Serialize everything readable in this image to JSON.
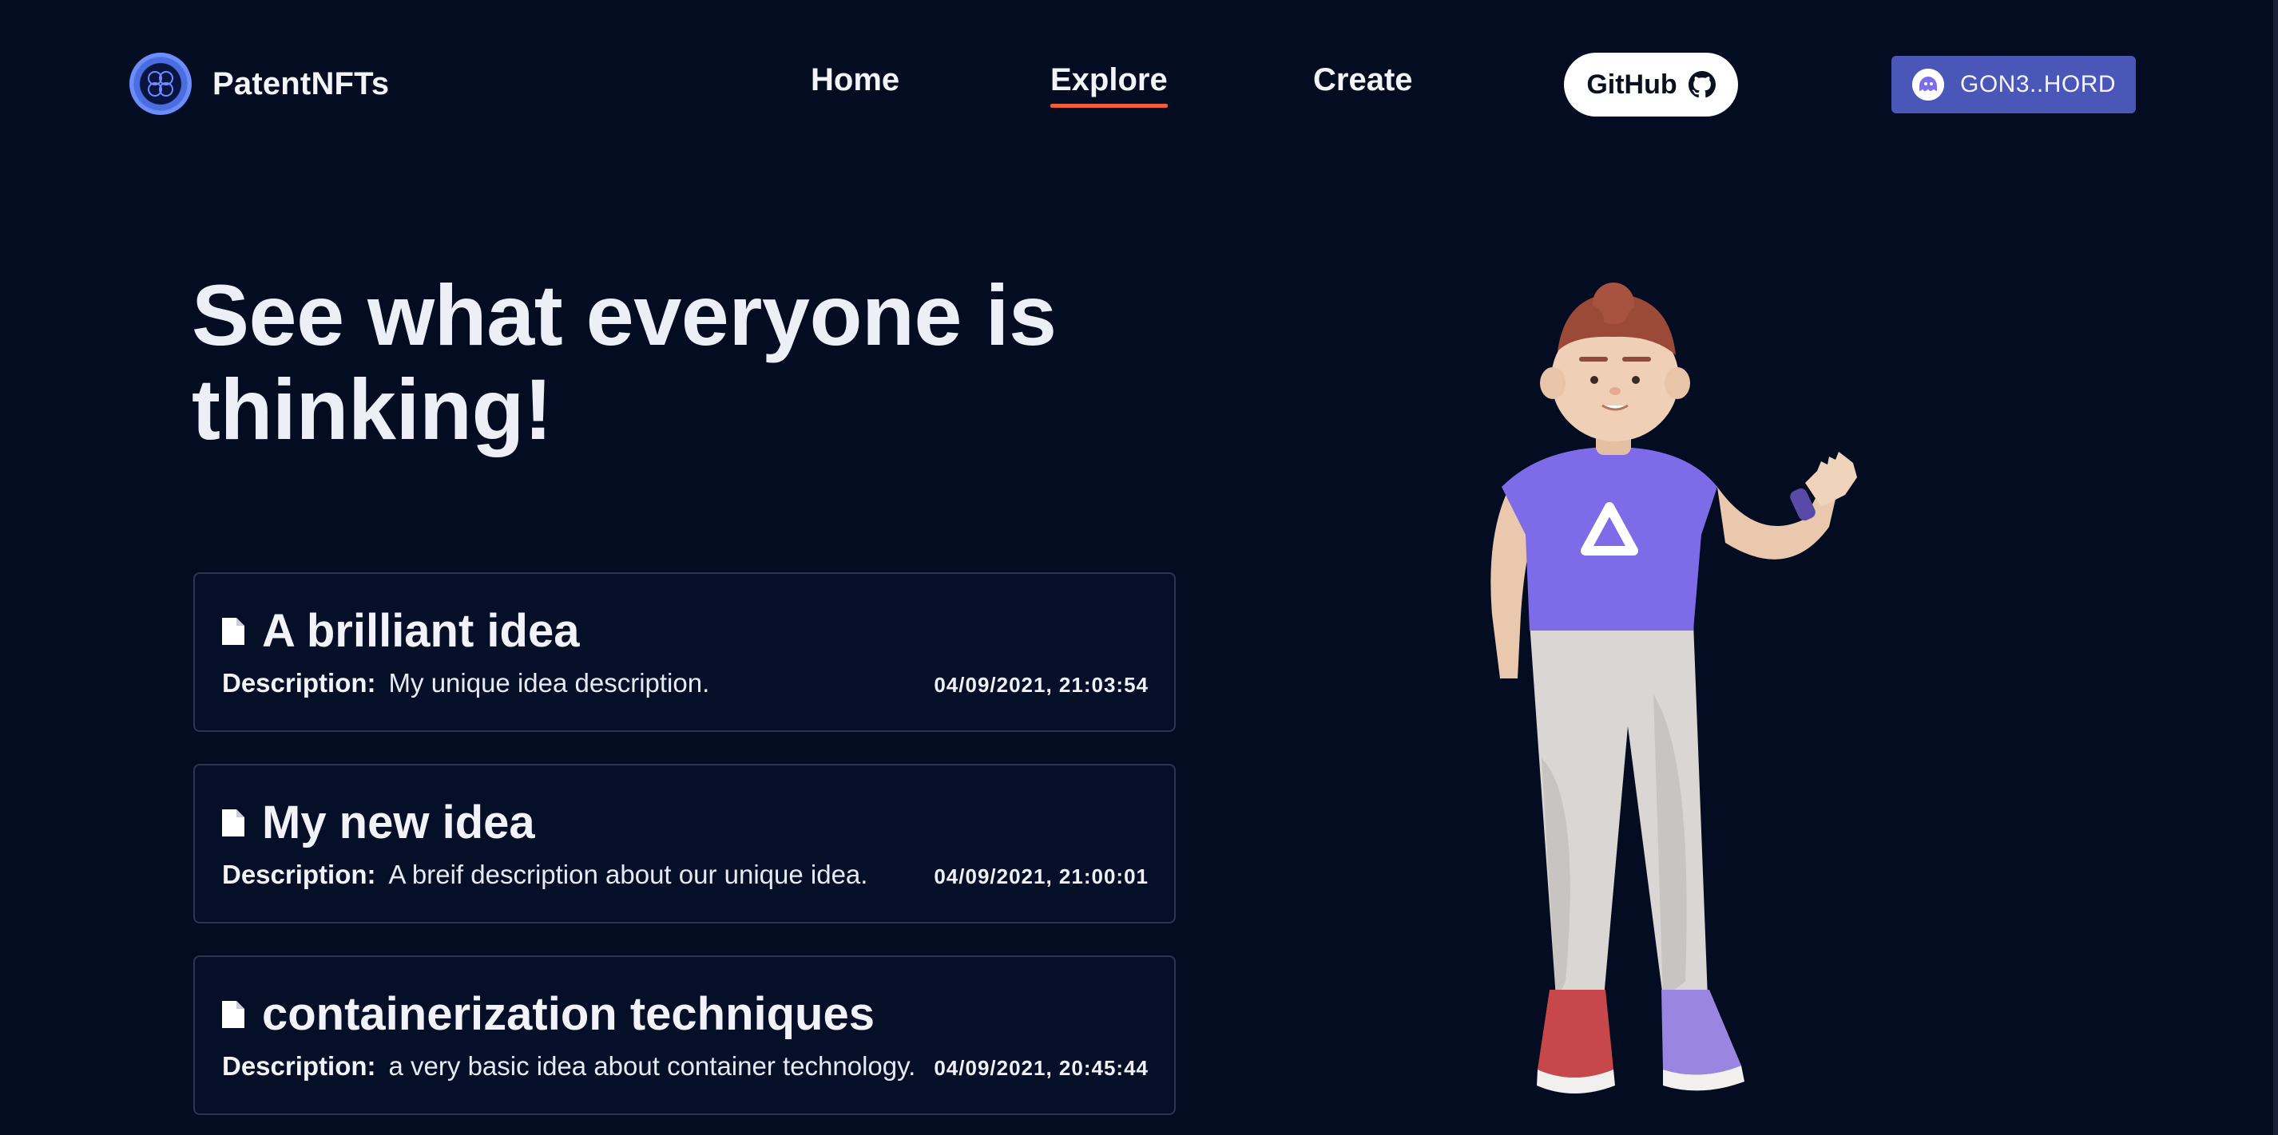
{
  "header": {
    "brand_name": "PatentNFTs",
    "nav": {
      "home": "Home",
      "explore": "Explore",
      "create": "Create"
    },
    "active_nav": "Explore",
    "github_label": "GitHub",
    "wallet_label": "GON3..HORD"
  },
  "hero": {
    "title": "See what everyone is thinking!"
  },
  "ideas": [
    {
      "title": "A brilliant idea",
      "description_label": "Description:",
      "description": "My unique idea description.",
      "timestamp": "04/09/2021, 21:03:54"
    },
    {
      "title": "My new idea",
      "description_label": "Description:",
      "description": "A breif description about our unique idea.",
      "timestamp": "04/09/2021, 21:00:01"
    },
    {
      "title": "containerization techniques",
      "description_label": "Description:",
      "description": "a very basic idea about container technology.",
      "timestamp": "04/09/2021, 20:45:44"
    }
  ],
  "colors": {
    "background": "#040c22",
    "accent_underline": "#ef5e3f",
    "wallet_button": "#4a56b8",
    "card_border": "#2a3552"
  },
  "icons": {
    "brand": "brand-logo-icon",
    "github": "github-icon",
    "wallet": "phantom-wallet-icon",
    "document": "document-icon"
  }
}
